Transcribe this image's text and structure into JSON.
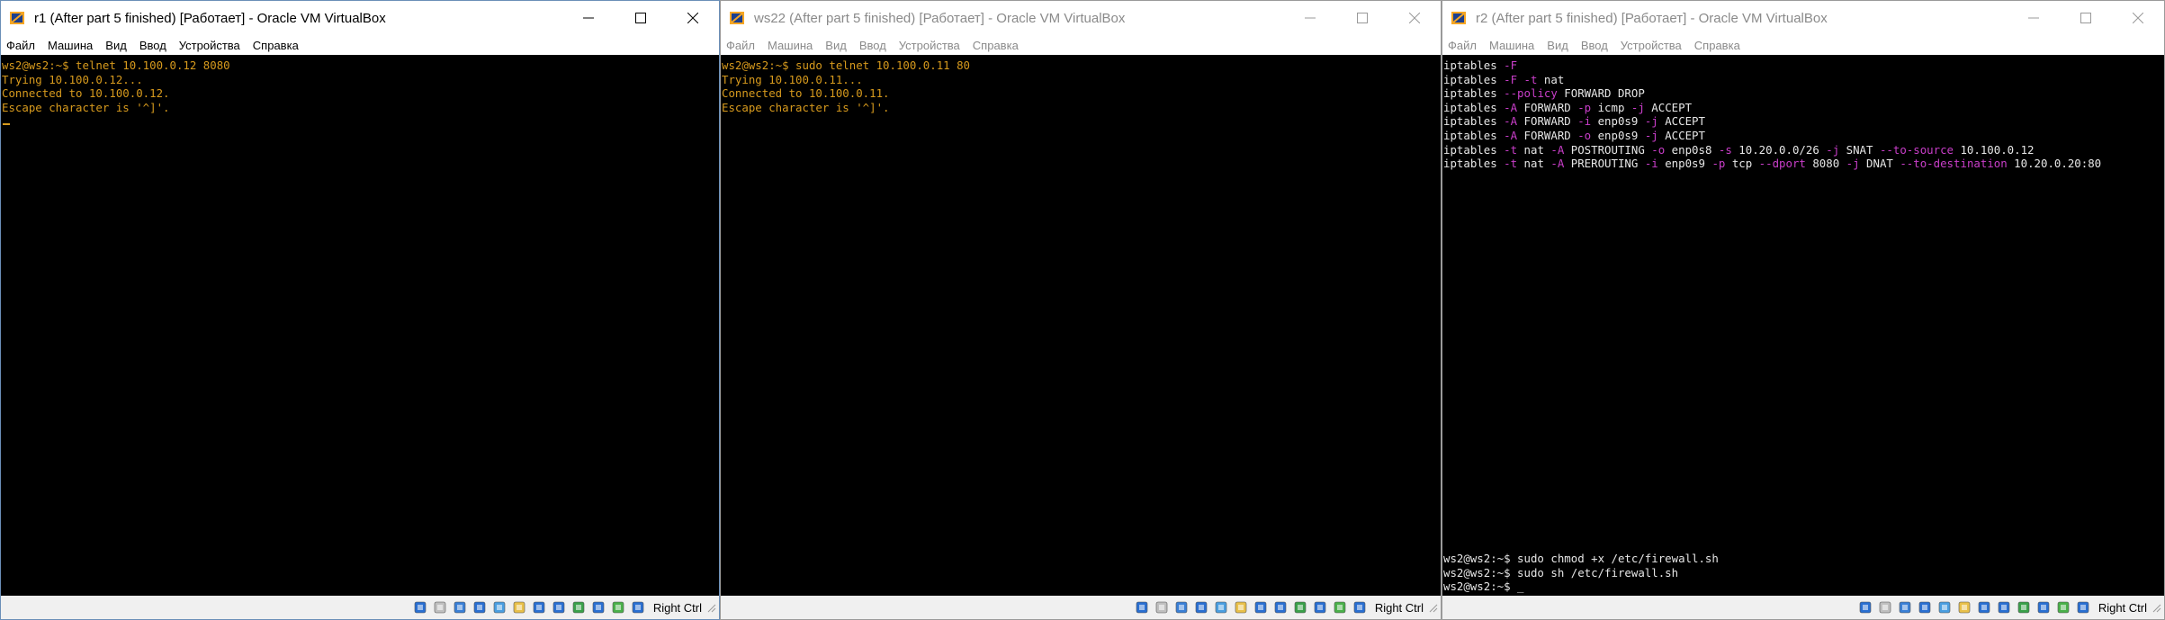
{
  "windows": [
    {
      "title": "r1 (After part 5 finished) [Работает] - Oracle VM VirtualBox",
      "active": true,
      "menu": [
        "Файл",
        "Машина",
        "Вид",
        "Ввод",
        "Устройства",
        "Справка"
      ],
      "terminal": [
        "ws2@ws2:~$ telnet 10.100.0.12 8080",
        "Trying 10.100.0.12...",
        "Connected to 10.100.0.12.",
        "Escape character is '^]'."
      ],
      "host_key": "Right Ctrl"
    },
    {
      "title": "ws22 (After part 5 finished) [Работает] - Oracle VM VirtualBox",
      "active": false,
      "menu": [
        "Файл",
        "Машина",
        "Вид",
        "Ввод",
        "Устройства",
        "Справка"
      ],
      "terminal": [
        "ws2@ws2:~$ sudo telnet 10.100.0.11 80",
        "Trying 10.100.0.11...",
        "Connected to 10.100.0.11.",
        "Escape character is '^]'."
      ],
      "host_key": "Right Ctrl"
    },
    {
      "title": "r2 (After part 5 finished) [Работает] - Oracle VM VirtualBox",
      "active": false,
      "menu": [
        "Файл",
        "Машина",
        "Вид",
        "Ввод",
        "Устройства",
        "Справка"
      ],
      "script_lines": [
        [
          {
            "t": "iptables "
          },
          {
            "t": "-F",
            "f": 1
          }
        ],
        [
          {
            "t": "iptables "
          },
          {
            "t": "-F",
            "f": 1
          },
          {
            "t": " "
          },
          {
            "t": "-t",
            "f": 1
          },
          {
            "t": " nat"
          }
        ],
        [
          {
            "t": "iptables "
          },
          {
            "t": "--policy",
            "f": 1
          },
          {
            "t": " FORWARD DROP"
          }
        ],
        [
          {
            "t": "iptables "
          },
          {
            "t": "-A",
            "f": 1
          },
          {
            "t": " FORWARD "
          },
          {
            "t": "-p",
            "f": 1
          },
          {
            "t": " icmp "
          },
          {
            "t": "-j",
            "f": 1
          },
          {
            "t": " ACCEPT"
          }
        ],
        [
          {
            "t": "iptables "
          },
          {
            "t": "-A",
            "f": 1
          },
          {
            "t": " FORWARD "
          },
          {
            "t": "-i",
            "f": 1
          },
          {
            "t": " enp0s9 "
          },
          {
            "t": "-j",
            "f": 1
          },
          {
            "t": " ACCEPT"
          }
        ],
        [
          {
            "t": "iptables "
          },
          {
            "t": "-A",
            "f": 1
          },
          {
            "t": " FORWARD "
          },
          {
            "t": "-o",
            "f": 1
          },
          {
            "t": " enp0s9 "
          },
          {
            "t": "-j",
            "f": 1
          },
          {
            "t": " ACCEPT"
          }
        ],
        [
          {
            "t": "iptables "
          },
          {
            "t": "-t",
            "f": 1
          },
          {
            "t": " nat "
          },
          {
            "t": "-A",
            "f": 1
          },
          {
            "t": " POSTROUTING "
          },
          {
            "t": "-o",
            "f": 1
          },
          {
            "t": " enp0s8 "
          },
          {
            "t": "-s",
            "f": 1
          },
          {
            "t": " 10.20.0.0/26 "
          },
          {
            "t": "-j",
            "f": 1
          },
          {
            "t": " SNAT "
          },
          {
            "t": "--to-source",
            "f": 1
          },
          {
            "t": " 10.100.0.12"
          }
        ],
        [
          {
            "t": "iptables "
          },
          {
            "t": "-t",
            "f": 1
          },
          {
            "t": " nat "
          },
          {
            "t": "-A",
            "f": 1
          },
          {
            "t": " PREROUTING "
          },
          {
            "t": "-i",
            "f": 1
          },
          {
            "t": " enp0s9 "
          },
          {
            "t": "-p",
            "f": 1
          },
          {
            "t": " tcp "
          },
          {
            "t": "--dport",
            "f": 1
          },
          {
            "t": " 8080 "
          },
          {
            "t": "-j",
            "f": 1
          },
          {
            "t": " DNAT "
          },
          {
            "t": "--to-destination",
            "f": 1
          },
          {
            "t": " 10.20.0.20:80"
          }
        ]
      ],
      "terminal": [
        "ws2@ws2:~$ sudo chmod +x /etc/firewall.sh",
        "ws2@ws2:~$ sudo sh /etc/firewall.sh",
        "ws2@ws2:~$ _"
      ],
      "host_key": "Right Ctrl"
    }
  ],
  "icons": [
    "hdd-icon",
    "optical-icon",
    "audio-icon",
    "network-icon",
    "usb-icon",
    "shared-folder-icon",
    "display-icon",
    "video-capture-icon",
    "recording-icon",
    "cpu-icon",
    "mouse-integration-icon",
    "keyboard-icon"
  ],
  "colors": {
    "prompt_text": "#d79a1d",
    "script_flag": "#c93ec9",
    "script_text": "#e6e6e6",
    "screen": "#000000"
  }
}
